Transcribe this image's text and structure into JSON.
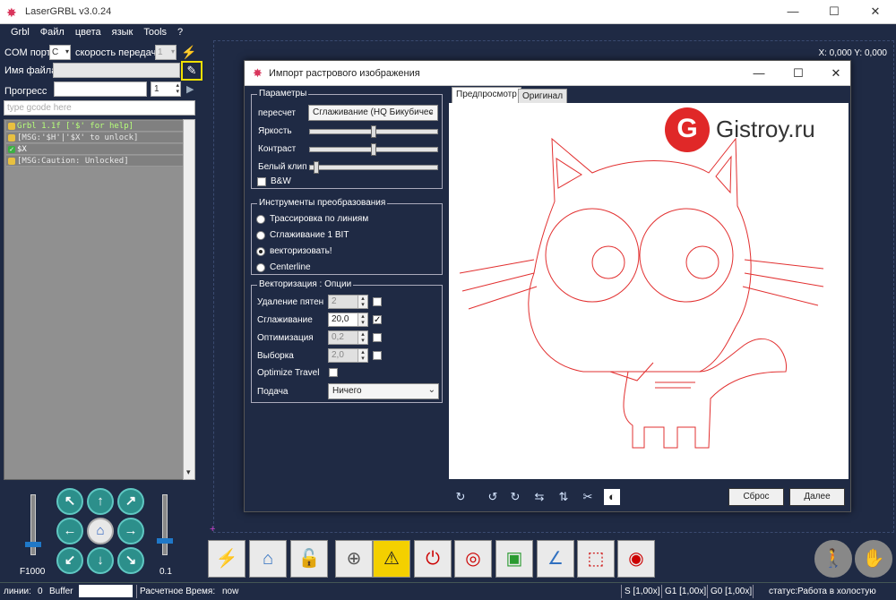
{
  "app": {
    "title": "LaserGRBL v3.0.24",
    "min": "—",
    "max": "☐",
    "close": "✕"
  },
  "menu": [
    "Grbl",
    "Файл",
    "цвета",
    "язык",
    "Tools",
    "?"
  ],
  "left": {
    "com_label": "COM порт",
    "com_value": "C",
    "baud_label": "скорость передачи",
    "baud_value": "1",
    "file_label": "Имя файла",
    "file_value": "",
    "progress_label": "Прогресс",
    "progress_count": "1",
    "gcode_placeholder": "type gcode here",
    "console": [
      {
        "text": "Grbl 1.1f ['$' for help]",
        "state": "ok"
      },
      {
        "text": "[MSG:'$H'|'$X' to unlock]",
        "state": "info"
      },
      {
        "text": "$X",
        "state": "check"
      },
      {
        "text": "[MSG:Caution: Unlocked]",
        "state": "info"
      }
    ],
    "feed_label": "F1000",
    "step_label": "0.1"
  },
  "coords": "X: 0,000 Y: 0,000",
  "status": {
    "lines_label": "линии:",
    "lines_value": "0",
    "buffer_label": "Buffer",
    "time_label": "Расчетное Время:",
    "time_value": "now",
    "s": "S [1,00x]",
    "g1": "G1 [1,00x]",
    "g0": "G0 [1,00x]",
    "state_label": "статус:",
    "state_value": "Работа в холостую"
  },
  "dialog": {
    "title": "Импорт растрового изображения",
    "params": {
      "title": "Параметры",
      "resample_label": "пересчет",
      "resample_value": "Сглаживание (HQ Бикубичес",
      "brightness": "Яркость",
      "contrast": "Контраст",
      "white_clip": "Белый клип",
      "bw": "B&W",
      "brightness_level": 0.5,
      "contrast_level": 0.5,
      "white_clip_level": 0.03
    },
    "tools": {
      "title": "Инструменты преобразования",
      "options": [
        "Трассировка по линиям",
        "Сглаживание 1 BIT",
        "векторизовать!",
        "Centerline"
      ],
      "selected": 2
    },
    "vector": {
      "title": "Векторизация : Опции",
      "rows": [
        {
          "label": "Удаление пятен",
          "value": "2",
          "checked": false,
          "active": false
        },
        {
          "label": "Сглаживание",
          "value": "20,0",
          "checked": true,
          "active": true
        },
        {
          "label": "Оптимизация",
          "value": "0,2",
          "checked": false,
          "active": false
        },
        {
          "label": "Выборка",
          "value": "2,0",
          "checked": false,
          "active": false
        }
      ],
      "optimize_travel": "Optimize Travel",
      "feed_label": "Подача",
      "feed_value": "Ничего"
    },
    "tabs": [
      "Предпросмотр",
      "Оригинал"
    ],
    "watermark": "Gistroy.ru",
    "reset": "Сброс",
    "next": "Далее"
  }
}
